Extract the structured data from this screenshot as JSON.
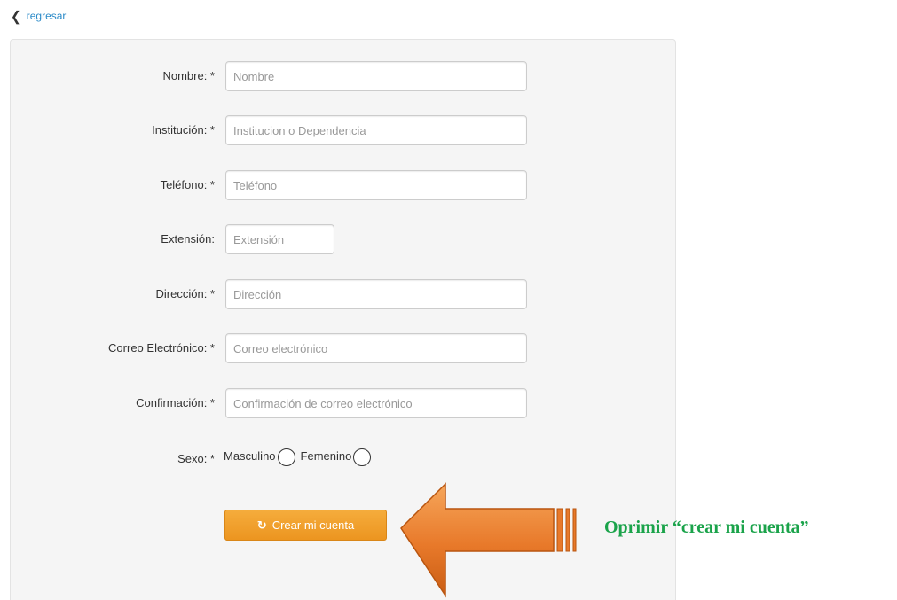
{
  "back_link": {
    "label": "regresar",
    "icon": "chevron-left-icon"
  },
  "form": {
    "fields": [
      {
        "label": "Nombre: *",
        "placeholder": "Nombre"
      },
      {
        "label": "Institución: *",
        "placeholder": "Institucion o Dependencia"
      },
      {
        "label": "Teléfono: *",
        "placeholder": "Teléfono"
      },
      {
        "label": "Extensión:",
        "placeholder": "Extensión"
      },
      {
        "label": "Dirección: *",
        "placeholder": "Dirección"
      },
      {
        "label": "Correo Electrónico: *",
        "placeholder": "Correo electrónico"
      },
      {
        "label": "Confirmación: *",
        "placeholder": "Confirmación de correo electrónico"
      }
    ],
    "sexo": {
      "label": "Sexo: *",
      "options": [
        "Masculino",
        "Femenino"
      ]
    },
    "submit": {
      "label": "Crear mi cuenta",
      "icon": "refresh-icon"
    }
  },
  "annotation": {
    "text": "Oprimir “crear mi cuenta”",
    "arrow_color": "#e8792a",
    "text_color": "#1aa34a"
  },
  "colors": {
    "link": "#2a8ac8",
    "button": "#f0a030",
    "panel": "#f5f5f5"
  }
}
